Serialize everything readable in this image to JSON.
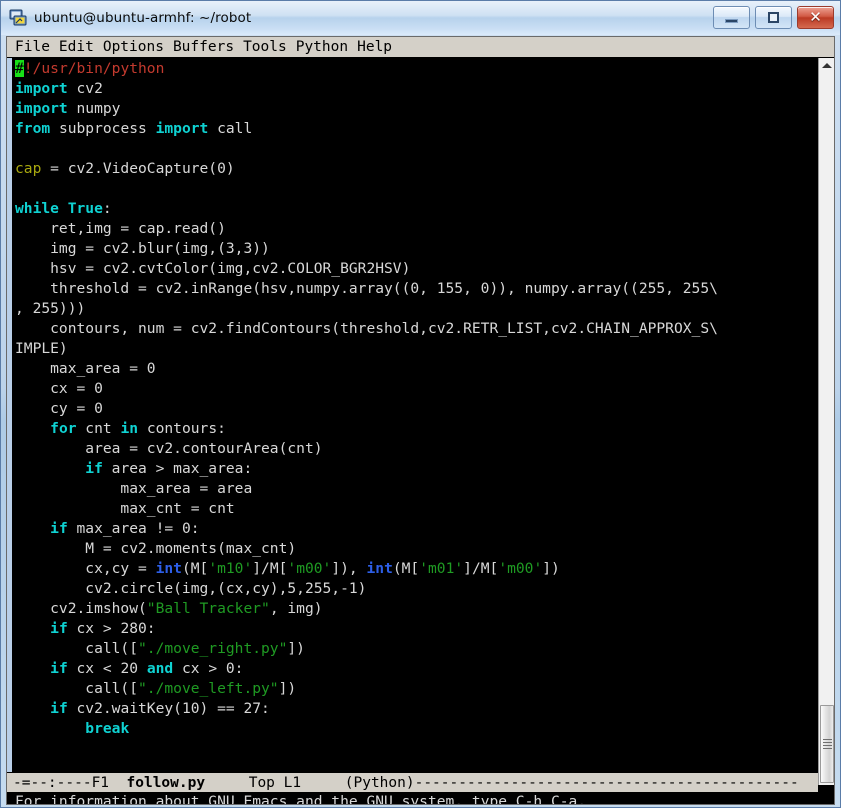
{
  "window": {
    "title": "ubuntu@ubuntu-armhf: ~/robot",
    "icon": "terminal-icon",
    "buttons": {
      "minimize": "minimize-icon",
      "maximize": "maximize-icon",
      "close": "✕"
    }
  },
  "menubar": {
    "items": [
      "File",
      "Edit",
      "Options",
      "Buffers",
      "Tools",
      "Python",
      "Help"
    ]
  },
  "editor": {
    "buffer_name": "follow.py",
    "cursor_char": "#",
    "lines": [
      [
        {
          "t": "#",
          "c": "cur"
        },
        {
          "t": "!/usr/bin/python",
          "c": "cmt"
        }
      ],
      [
        {
          "t": "import",
          "c": "kw"
        },
        {
          "t": " cv2",
          "c": "pl"
        }
      ],
      [
        {
          "t": "import",
          "c": "kw"
        },
        {
          "t": " numpy",
          "c": "pl"
        }
      ],
      [
        {
          "t": "from",
          "c": "kw"
        },
        {
          "t": " subprocess ",
          "c": "pl"
        },
        {
          "t": "import",
          "c": "kw"
        },
        {
          "t": " call",
          "c": "pl"
        }
      ],
      [],
      [
        {
          "t": "cap",
          "c": "var"
        },
        {
          "t": " = cv2.VideoCapture(0)",
          "c": "pl"
        }
      ],
      [],
      [
        {
          "t": "while",
          "c": "kw"
        },
        {
          "t": " ",
          "c": "pl"
        },
        {
          "t": "True",
          "c": "kw"
        },
        {
          "t": ":",
          "c": "pl"
        }
      ],
      [
        {
          "t": "    ret,img = cap.read()",
          "c": "pl"
        }
      ],
      [
        {
          "t": "    img = cv2.blur(img,(3,3))",
          "c": "pl"
        }
      ],
      [
        {
          "t": "    hsv = cv2.cvtColor(img,cv2.COLOR_BGR2HSV)",
          "c": "pl"
        }
      ],
      [
        {
          "t": "    threshold = cv2.inRange(hsv,numpy.array((0, 155, 0)), numpy.array((255, 255\\",
          "c": "pl"
        }
      ],
      [
        {
          "t": ", 255)))",
          "c": "pl"
        }
      ],
      [
        {
          "t": "    contours, num = cv2.findContours(threshold,cv2.RETR_LIST,cv2.CHAIN_APPROX_S\\",
          "c": "pl"
        }
      ],
      [
        {
          "t": "IMPLE)",
          "c": "pl"
        }
      ],
      [
        {
          "t": "    max_area = 0",
          "c": "pl"
        }
      ],
      [
        {
          "t": "    cx = 0",
          "c": "pl"
        }
      ],
      [
        {
          "t": "    cy = 0",
          "c": "pl"
        }
      ],
      [
        {
          "t": "    ",
          "c": "pl"
        },
        {
          "t": "for",
          "c": "kw"
        },
        {
          "t": " cnt ",
          "c": "pl"
        },
        {
          "t": "in",
          "c": "kw"
        },
        {
          "t": " contours:",
          "c": "pl"
        }
      ],
      [
        {
          "t": "        area = cv2.contourArea(cnt)",
          "c": "pl"
        }
      ],
      [
        {
          "t": "        ",
          "c": "pl"
        },
        {
          "t": "if",
          "c": "kw"
        },
        {
          "t": " area > max_area:",
          "c": "pl"
        }
      ],
      [
        {
          "t": "            max_area = area",
          "c": "pl"
        }
      ],
      [
        {
          "t": "            max_cnt = cnt",
          "c": "pl"
        }
      ],
      [
        {
          "t": "    ",
          "c": "pl"
        },
        {
          "t": "if",
          "c": "kw"
        },
        {
          "t": " max_area != 0:",
          "c": "pl"
        }
      ],
      [
        {
          "t": "        M = cv2.moments(max_cnt)",
          "c": "pl"
        }
      ],
      [
        {
          "t": "        cx,cy = ",
          "c": "pl"
        },
        {
          "t": "int",
          "c": "bi"
        },
        {
          "t": "(M[",
          "c": "pl"
        },
        {
          "t": "'m10'",
          "c": "str"
        },
        {
          "t": "]/M[",
          "c": "pl"
        },
        {
          "t": "'m00'",
          "c": "str"
        },
        {
          "t": "]), ",
          "c": "pl"
        },
        {
          "t": "int",
          "c": "bi"
        },
        {
          "t": "(M[",
          "c": "pl"
        },
        {
          "t": "'m01'",
          "c": "str"
        },
        {
          "t": "]/M[",
          "c": "pl"
        },
        {
          "t": "'m00'",
          "c": "str"
        },
        {
          "t": "])",
          "c": "pl"
        }
      ],
      [
        {
          "t": "        cv2.circle(img,(cx,cy),5,255,-1)",
          "c": "pl"
        }
      ],
      [
        {
          "t": "    cv2.imshow(",
          "c": "pl"
        },
        {
          "t": "\"Ball Tracker\"",
          "c": "str"
        },
        {
          "t": ", img)",
          "c": "pl"
        }
      ],
      [
        {
          "t": "    ",
          "c": "pl"
        },
        {
          "t": "if",
          "c": "kw"
        },
        {
          "t": " cx > 280:",
          "c": "pl"
        }
      ],
      [
        {
          "t": "        call([",
          "c": "pl"
        },
        {
          "t": "\"./move_right.py\"",
          "c": "str"
        },
        {
          "t": "])",
          "c": "pl"
        }
      ],
      [
        {
          "t": "    ",
          "c": "pl"
        },
        {
          "t": "if",
          "c": "kw"
        },
        {
          "t": " cx < 20 ",
          "c": "pl"
        },
        {
          "t": "and",
          "c": "kw"
        },
        {
          "t": " cx > 0:",
          "c": "pl"
        }
      ],
      [
        {
          "t": "        call([",
          "c": "pl"
        },
        {
          "t": "\"./move_left.py\"",
          "c": "str"
        },
        {
          "t": "])",
          "c": "pl"
        }
      ],
      [
        {
          "t": "    ",
          "c": "pl"
        },
        {
          "t": "if",
          "c": "kw"
        },
        {
          "t": " cv2.waitKey(10) == 27:",
          "c": "pl"
        }
      ],
      [
        {
          "t": "        ",
          "c": "pl"
        },
        {
          "t": "break",
          "c": "kw"
        }
      ]
    ]
  },
  "modeline": {
    "prefix": "-=--:----F1  ",
    "buffer": "follow.py",
    "position": "     Top L1     (Python)",
    "filler": "--------------------------------------------"
  },
  "minibuffer": {
    "message": "For information about GNU Emacs and the GNU system, type C-h C-a."
  },
  "scrollbar": {
    "up_arrow": "scroll-up-arrow-icon",
    "thumb": "scroll-thumb"
  },
  "colors": {
    "keyword": "#0fd2d2",
    "builtin": "#2d5fe8",
    "string": "#1f9b23",
    "comment": "#c33a2e",
    "variable": "#a8a80f",
    "plain": "#d8d8d8",
    "cursor": "#18e018",
    "background": "#000000",
    "modeline_bg": "#d4d0c8"
  }
}
